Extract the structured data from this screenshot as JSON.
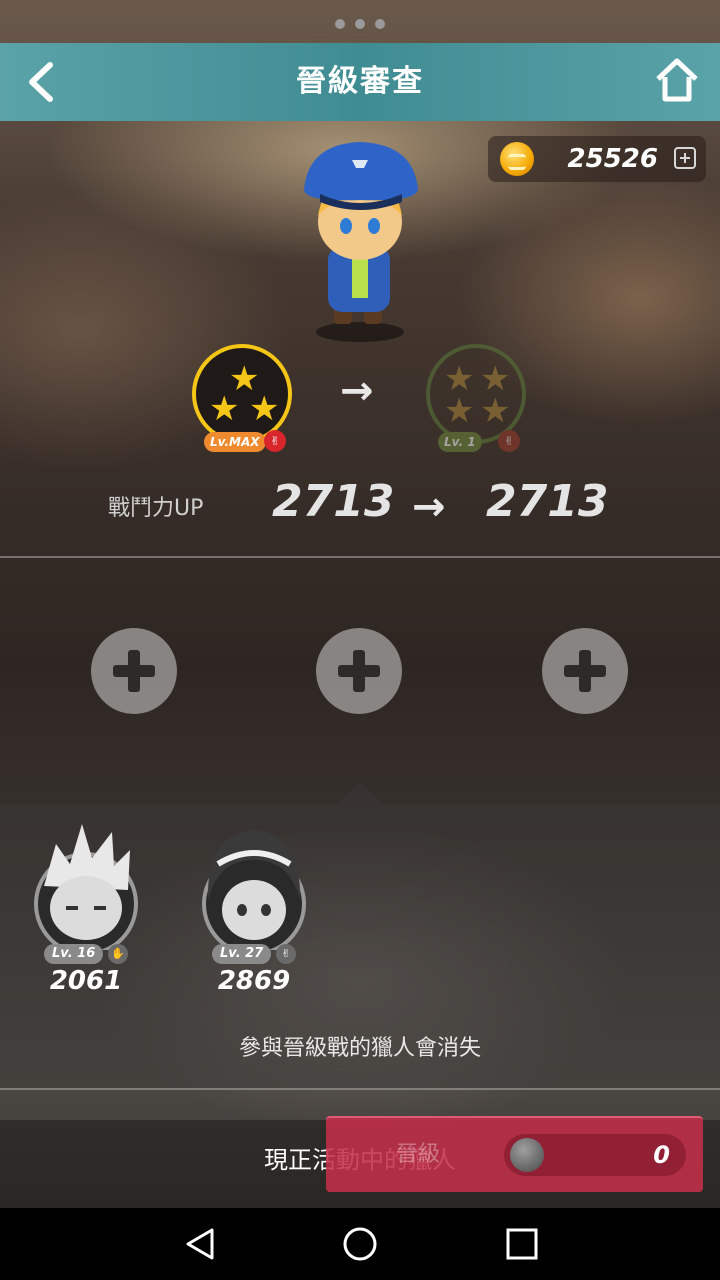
{
  "header": {
    "title": "晉級審查",
    "back_icon": "chevron-left-icon",
    "home_icon": "home-icon"
  },
  "currency": {
    "icon": "gold-coin-icon",
    "value": "25526",
    "add_icon": "plus-box-icon"
  },
  "rank": {
    "current": {
      "stars": 3,
      "level_label": "Lv.MAX"
    },
    "next": {
      "stars": 4,
      "level_label": "Lv. 1"
    }
  },
  "power": {
    "label": "戰鬥力UP",
    "current": "2713",
    "next": "2713"
  },
  "material_slots": [
    {
      "icon": "plus-icon"
    },
    {
      "icon": "plus-icon"
    },
    {
      "icon": "plus-icon"
    }
  ],
  "hunters": [
    {
      "level": "Lv. 16",
      "power": "2061"
    },
    {
      "level": "Lv. 27",
      "power": "2869"
    }
  ],
  "notice": "參與晉級戰的獵人會消失",
  "active_hunters_label": "現正活動中的獵人",
  "promote": {
    "label": "晉級",
    "cost": "0",
    "cost_icon": "silver-coin-icon"
  },
  "colors": {
    "header_bar": "#3f8c92",
    "promote_button": "#c4304a",
    "star": "#f5c518"
  }
}
